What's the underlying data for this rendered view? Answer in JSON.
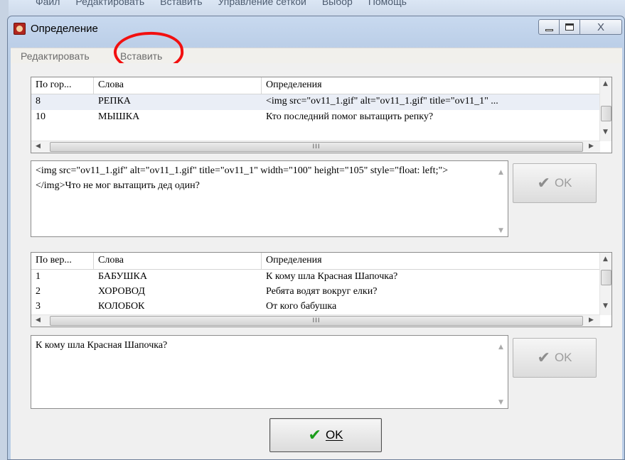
{
  "background_app": {
    "menu": [
      "Файл",
      "Редактировать",
      "Вставить",
      "Управление сеткой",
      "Выбор",
      "Помощь"
    ]
  },
  "window": {
    "title": "Определение",
    "close_glyph": "X"
  },
  "menubar": {
    "edit": "Редактировать",
    "insert": "Вставить"
  },
  "across_list": {
    "headers": [
      "По гор...",
      "Слова",
      "Определения"
    ],
    "rows": [
      {
        "num": "8",
        "word": "РЕПКА",
        "definition": "<img src=\"ov11_1.gif\" alt=\"ov11_1.gif\" title=\"ov11_1\" ..."
      },
      {
        "num": "10",
        "word": "МЫШКА",
        "definition": "Кто последний помог вытащить репку?"
      }
    ],
    "hscroll_mark": "III"
  },
  "across_memo": {
    "text": "<img src=\"ov11_1.gif\" alt=\"ov11_1.gif\" title=\"ov11_1\" width=\"100\" height=\"105\" style=\"float: left;\"></img>Что не мог вытащить дед один?"
  },
  "down_list": {
    "headers": [
      "По вер...",
      "Слова",
      "Определения"
    ],
    "rows": [
      {
        "num": "1",
        "word": "БАБУШКА",
        "definition": "К кому шла Красная Шапочка?"
      },
      {
        "num": "2",
        "word": "ХОРОВОД",
        "definition": "Ребята водят вокруг елки?"
      },
      {
        "num": "3",
        "word": "КОЛОБОК",
        "definition": "От кого бабушка"
      }
    ],
    "hscroll_mark": "III"
  },
  "down_memo": {
    "text": "К кому шла Красная Шапочка?"
  },
  "buttons": {
    "ok_label": "OK",
    "ok_label_main": "OK",
    "check_glyph": "✔"
  }
}
